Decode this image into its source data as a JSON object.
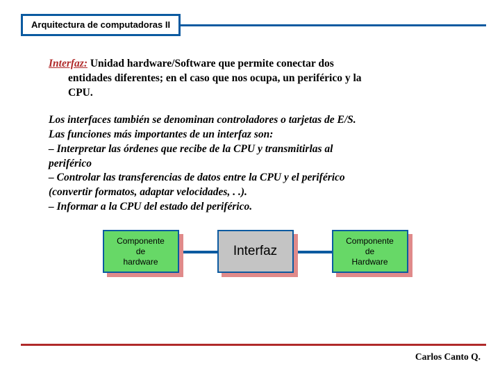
{
  "header": {
    "title": "Arquitectura de computadoras II"
  },
  "definition": {
    "label": "Interfaz:",
    "line1_rest": "  Unidad hardware/Software que permite conectar dos",
    "line2": "entidades diferentes; en el caso que nos ocupa, un periférico y la",
    "line3": "CPU."
  },
  "body": {
    "l1": "Los interfaces también se denominan controladores o tarjetas de E/S.",
    "l2": " Las funciones más importantes de un interfaz son:",
    "l3": "– Interpretar las órdenes que recibe de la CPU y transmitirlas al",
    "l4": "periférico",
    "l5": "– Controlar las transferencias de datos entre la CPU y el periférico",
    "l6": "(convertir formatos, adaptar velocidades, . .).",
    "l7": "– Informar a la CPU del estado del periférico."
  },
  "diagram": {
    "left": "Componente\nde\nhardware",
    "center": "Interfaz",
    "right": "Componente\nde\nHardware"
  },
  "footer": {
    "author": "Carlos  Canto Q."
  }
}
